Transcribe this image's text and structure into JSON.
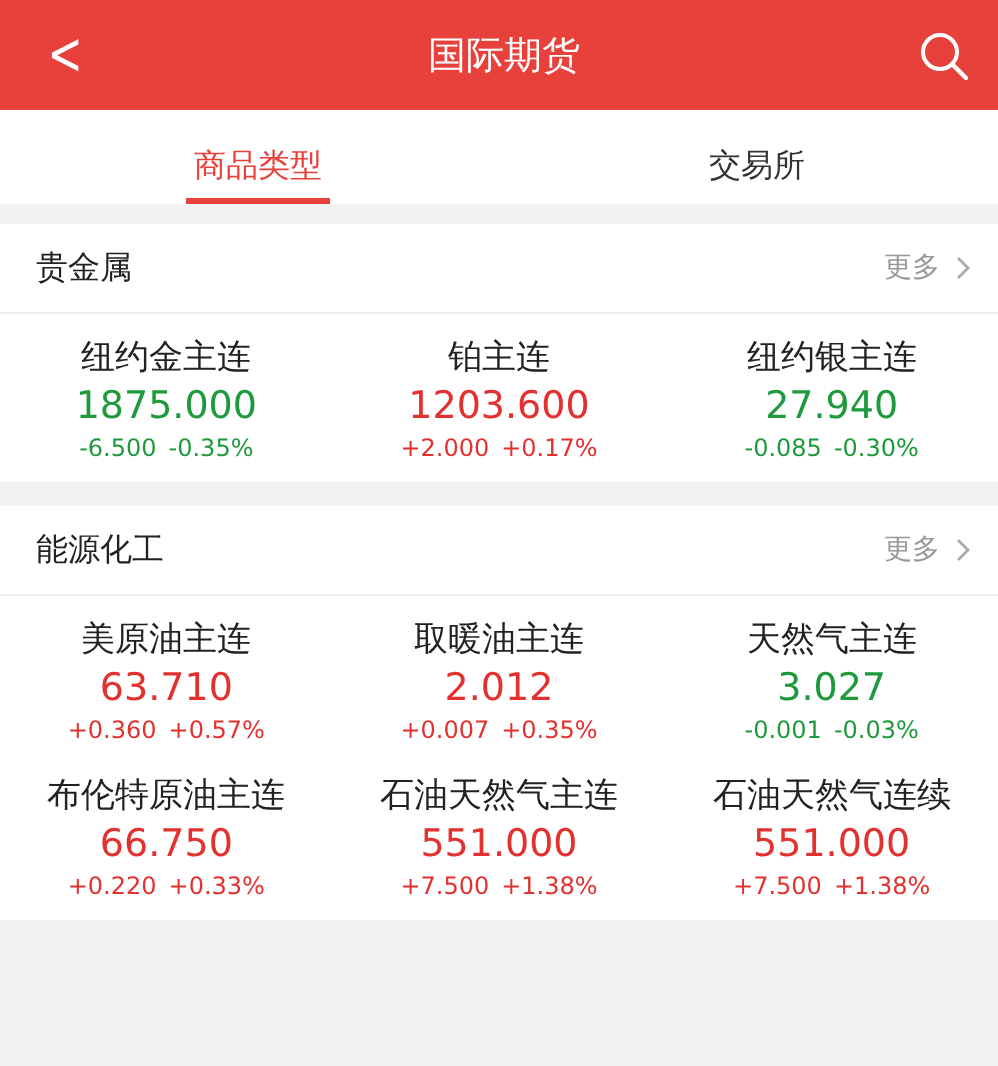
{
  "header": {
    "title": "国际期货",
    "back_symbol": "<"
  },
  "tabs": [
    {
      "label": "商品类型",
      "selected": true
    },
    {
      "label": "交易所",
      "selected": false
    }
  ],
  "sections": [
    {
      "title": "贵金属",
      "more": "更多",
      "items": [
        {
          "name": "纽约金主连",
          "price": "1875.000",
          "change": "-6.500",
          "percent": "-0.35%",
          "color": "#1e9a3c"
        },
        {
          "name": "铂主连",
          "price": "1203.600",
          "change": "+2.000",
          "percent": "+0.17%",
          "color": "#e2312f"
        },
        {
          "name": "纽约银主连",
          "price": "27.940",
          "change": "-0.085",
          "percent": "-0.30%",
          "color": "#1e9a3c"
        }
      ]
    },
    {
      "title": "能源化工",
      "more": "更多",
      "items": [
        {
          "name": "美原油主连",
          "price": "63.710",
          "change": "+0.360",
          "percent": "+0.57%",
          "color": "#e2312f"
        },
        {
          "name": "取暖油主连",
          "price": "2.012",
          "change": "+0.007",
          "percent": "+0.35%",
          "color": "#e2312f"
        },
        {
          "name": "天然气主连",
          "price": "3.027",
          "change": "-0.001",
          "percent": "-0.03%",
          "color": "#1e9a3c"
        },
        {
          "name": "布伦特原油主连",
          "price": "66.750",
          "change": "+0.220",
          "percent": "+0.33%",
          "color": "#e2312f"
        },
        {
          "name": "石油天然气主连",
          "price": "551.000",
          "change": "+7.500",
          "percent": "+1.38%",
          "color": "#e2312f"
        },
        {
          "name": "石油天然气连续",
          "price": "551.000",
          "change": "+7.500",
          "percent": "+1.38%",
          "color": "#e2312f"
        }
      ]
    }
  ]
}
